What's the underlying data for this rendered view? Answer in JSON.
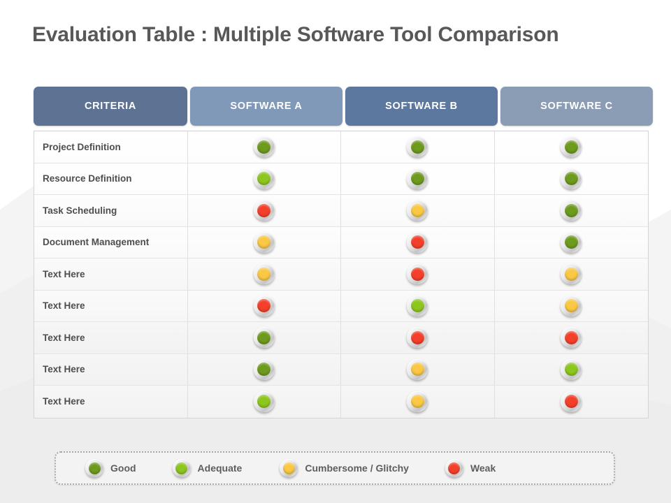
{
  "title": "Evaluation Table : Multiple Software Tool Comparison",
  "palette": {
    "good": "#6E9B1E",
    "adequate": "#8DC71E",
    "cumbersome": "#FBC844",
    "weak": "#F4402A",
    "header_criteria": "#5E7293",
    "header_a": "#8199B8",
    "header_b": "#5C789F",
    "header_c": "#8A9DB5",
    "title_color": "#58585A"
  },
  "table": {
    "headers": [
      {
        "label": "CRITERIA",
        "color": "#5E7293"
      },
      {
        "label": "SOFTWARE A",
        "color": "#8199B8"
      },
      {
        "label": "SOFTWARE B",
        "color": "#5C789F"
      },
      {
        "label": "SOFTWARE C",
        "color": "#8A9DB5"
      }
    ],
    "rows": [
      {
        "criteria": "Project Definition",
        "values": [
          "good",
          "good",
          "good"
        ]
      },
      {
        "criteria": "Resource Definition",
        "values": [
          "adequate",
          "good",
          "good"
        ]
      },
      {
        "criteria": "Task Scheduling",
        "values": [
          "weak",
          "cumbersome",
          "good"
        ]
      },
      {
        "criteria": "Document Management",
        "values": [
          "cumbersome",
          "weak",
          "good"
        ]
      },
      {
        "criteria": "Text Here",
        "values": [
          "cumbersome",
          "weak",
          "cumbersome"
        ]
      },
      {
        "criteria": "Text Here",
        "values": [
          "weak",
          "adequate",
          "cumbersome"
        ]
      },
      {
        "criteria": "Text Here",
        "values": [
          "good",
          "weak",
          "weak"
        ]
      },
      {
        "criteria": "Text Here",
        "values": [
          "good",
          "cumbersome",
          "adequate"
        ]
      },
      {
        "criteria": "Text Here",
        "values": [
          "adequate",
          "cumbersome",
          "weak"
        ]
      }
    ]
  },
  "legend": {
    "items": [
      {
        "key": "good",
        "label": "Good",
        "color": "#6E9B1E"
      },
      {
        "key": "adequate",
        "label": "Adequate",
        "color": "#8DC71E"
      },
      {
        "key": "cumbersome",
        "label": "Cumbersome / Glitchy",
        "color": "#FBC844"
      },
      {
        "key": "weak",
        "label": "Weak",
        "color": "#F4402A"
      }
    ]
  }
}
